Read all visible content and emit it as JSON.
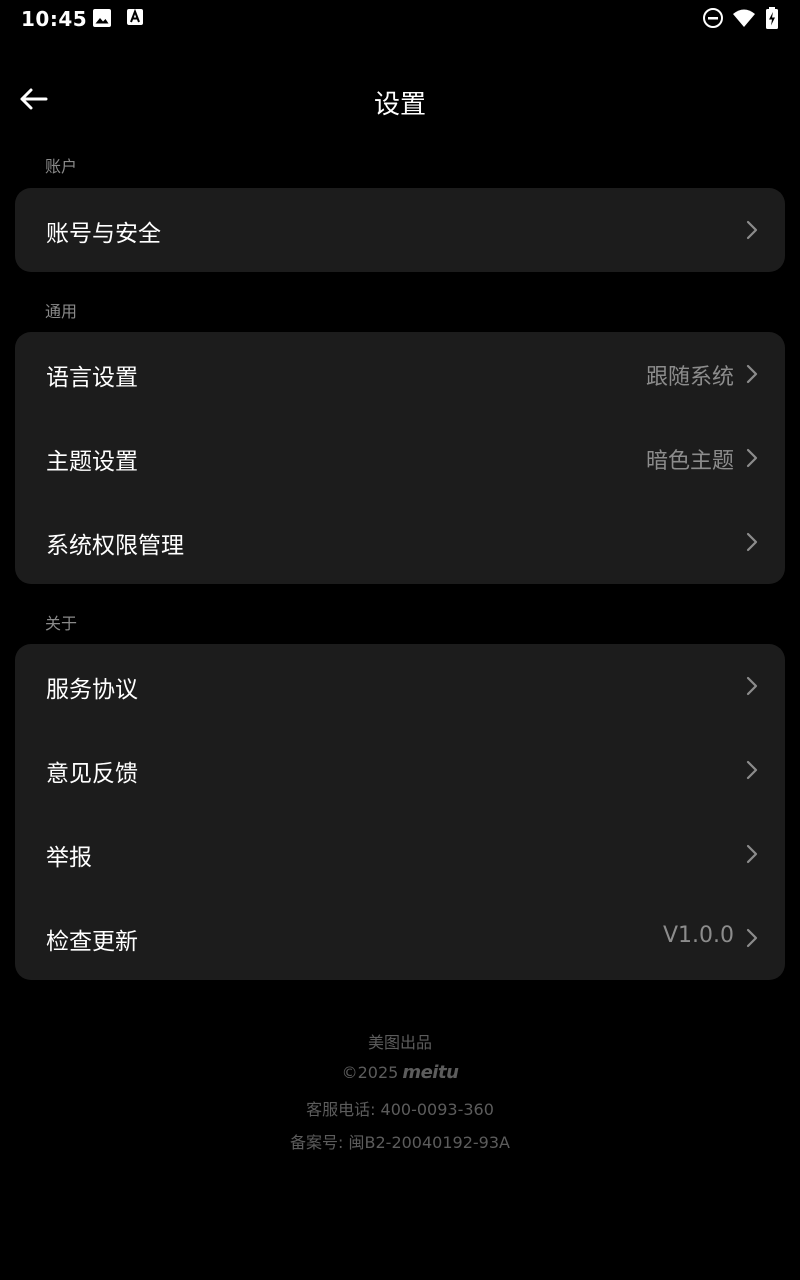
{
  "status_bar": {
    "time": "10:45",
    "left_icons": [
      "image-icon",
      "font-download-icon"
    ],
    "right_icons": [
      "do-not-disturb-icon",
      "wifi-icon",
      "battery-charging-icon"
    ]
  },
  "header": {
    "title": "设置",
    "back_icon": "back-arrow-icon"
  },
  "sections": [
    {
      "title": "账户",
      "items": [
        {
          "label": "账号与安全",
          "value": ""
        }
      ]
    },
    {
      "title": "通用",
      "items": [
        {
          "label": "语言设置",
          "value": "跟随系统"
        },
        {
          "label": "主题设置",
          "value": "暗色主题"
        },
        {
          "label": "系统权限管理",
          "value": ""
        }
      ]
    },
    {
      "title": "关于",
      "items": [
        {
          "label": "服务协议",
          "value": ""
        },
        {
          "label": "意见反馈",
          "value": ""
        },
        {
          "label": "举报",
          "value": ""
        },
        {
          "label": "检查更新",
          "value": "V1.0.0"
        }
      ]
    }
  ],
  "footer": {
    "producer": "美图出品",
    "copyright": "©2025",
    "brand": "meitu",
    "phone": "客服电话: 400-0093-360",
    "record": "备案号: 闽B2-20040192-93A"
  },
  "colors": {
    "background": "#000000",
    "card": "#1c1c1c",
    "primary_text": "#ffffff",
    "secondary_text": "#8c8c8c",
    "footer_text": "#5c5c5c"
  }
}
